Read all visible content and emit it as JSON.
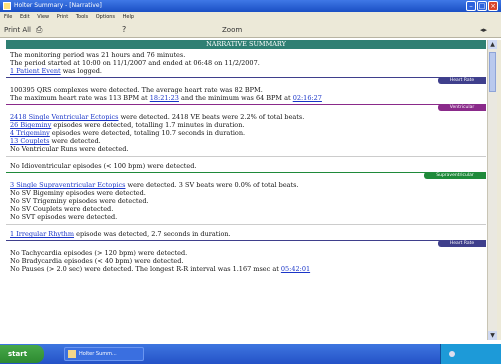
{
  "window": {
    "title": "Holter Summary - [Narrative]"
  },
  "menu": [
    "File",
    "Edit",
    "View",
    "Print",
    "Tools",
    "Options",
    "Help"
  ],
  "toolbar": {
    "print_label": "Print All",
    "zoom_label": "Zoom"
  },
  "report": {
    "banner": "NARRATIVE SUMMARY",
    "general": {
      "line1": "The monitoring period was 21 hours and 76 minutes.",
      "line2": "The period started at 10:00 on 11/1/2007 and ended at 06:48 on 11/2/2007.",
      "line3_link": "1 Patient Event",
      "line3_rest": " was logged."
    },
    "heart_rate": {
      "tag": "Heart Rate",
      "line1": "100395 QRS complexes were detected. The average heart rate was 82 BPM.",
      "line2_a": "The maximum heart rate was 113 BPM at ",
      "line2_link1": "18:21:23",
      "line2_b": " and the minimum was 64 BPM at ",
      "line2_link2": "02:16:27"
    },
    "ventricular": {
      "tag": "Ventricular",
      "line1_link": "2418 Single Ventricular Ectopics",
      "line1_rest": " were detected. 2418 VE beats were 2.2% of total beats.",
      "line2_link": "26 Bigeminy",
      "line2_rest": " episodes were detected, totalling 1.7 minutes in duration.",
      "line3_link": "4 Trigeminy",
      "line3_rest": " episodes were detected, totaling 10.7 seconds in duration.",
      "line4_link": "13 Couplets",
      "line4_rest": " were detected.",
      "line5": "No Ventricular Runs were detected.",
      "line6": "No Idioventricular episodes (< 100 bpm) were detected."
    },
    "supraventricular": {
      "tag": "Supraventricular",
      "line1_link": "3 Single Supraventricular Ectopics",
      "line1_rest": " were detected. 3 SV beats were 0.0% of total beats.",
      "line2": "No SV Bigeminy episodes were detected.",
      "line3": "No SV Trigeminy episodes were detected.",
      "line4": "No SV Couplets were detected.",
      "line5": "No SVT episodes were detected."
    },
    "irregular": {
      "line1_link": "1 Irregular Rhythm",
      "line1_rest": " episode was detected, 2.7 seconds in duration."
    },
    "heart_rate2": {
      "tag": "Heart Rate",
      "line1": "No Tachycardia episodes (> 120 bpm) were detected.",
      "line2": "No Bradycardia episodes (< 40 bpm) were detected.",
      "line3_a": "No Pauses (> 2.0 sec) were detected. The longest R-R interval was 1.167 msec at ",
      "line3_link": "05:42:01"
    }
  },
  "taskbar": {
    "start_label": "start",
    "task_label": "Holter Summ..."
  },
  "colors": {
    "banner": "#2f7f73",
    "tag_heart_rate": "#3f3f8c",
    "tag_ventricular": "#8a2a8a",
    "tag_supraventricular": "#1f8a3a"
  }
}
